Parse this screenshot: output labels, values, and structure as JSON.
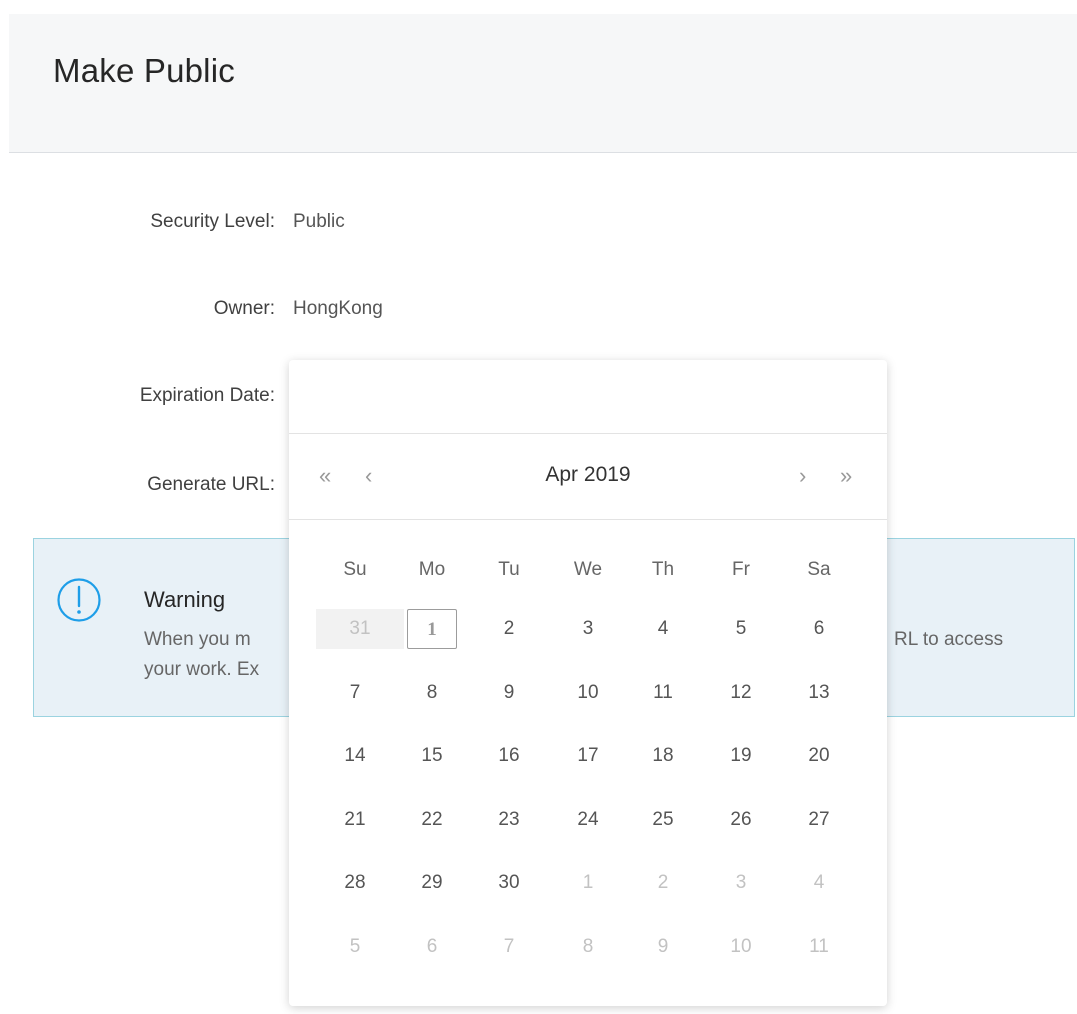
{
  "dialog": {
    "title": "Make Public"
  },
  "form": {
    "security_level": {
      "label": "Security Level",
      "value": "Public"
    },
    "owner": {
      "label": "Owner",
      "value": "HongKong"
    },
    "expiration_date": {
      "label": "Expiration Date"
    },
    "generate_url": {
      "label": "Generate URL"
    }
  },
  "warning": {
    "title": "Warning",
    "line1_visible_start": "When you m",
    "line1_visible_end": "RL to access",
    "line2_visible_start": "your work. Ex"
  },
  "calendar": {
    "month_year": "Apr 2019",
    "nav": {
      "prev_year": "«",
      "prev_month": "‹",
      "next_month": "›",
      "next_year": "»"
    },
    "weekdays": [
      "Su",
      "Mo",
      "Tu",
      "We",
      "Th",
      "Fr",
      "Sa"
    ],
    "weeks": [
      [
        "31",
        "1",
        "2",
        "3",
        "4",
        "5",
        "6"
      ],
      [
        "7",
        "8",
        "9",
        "10",
        "11",
        "12",
        "13"
      ],
      [
        "14",
        "15",
        "16",
        "17",
        "18",
        "19",
        "20"
      ],
      [
        "21",
        "22",
        "23",
        "24",
        "25",
        "26",
        "27"
      ],
      [
        "28",
        "29",
        "30",
        "1",
        "2",
        "3",
        "4"
      ],
      [
        "5",
        "6",
        "7",
        "8",
        "9",
        "10",
        "11"
      ]
    ],
    "today": "1"
  },
  "colors": {
    "header_bg": "#f6f7f8",
    "warning_bg": "#e8f1f7",
    "warning_border": "#9bd3e0",
    "info_icon": "#1e9ee8"
  }
}
